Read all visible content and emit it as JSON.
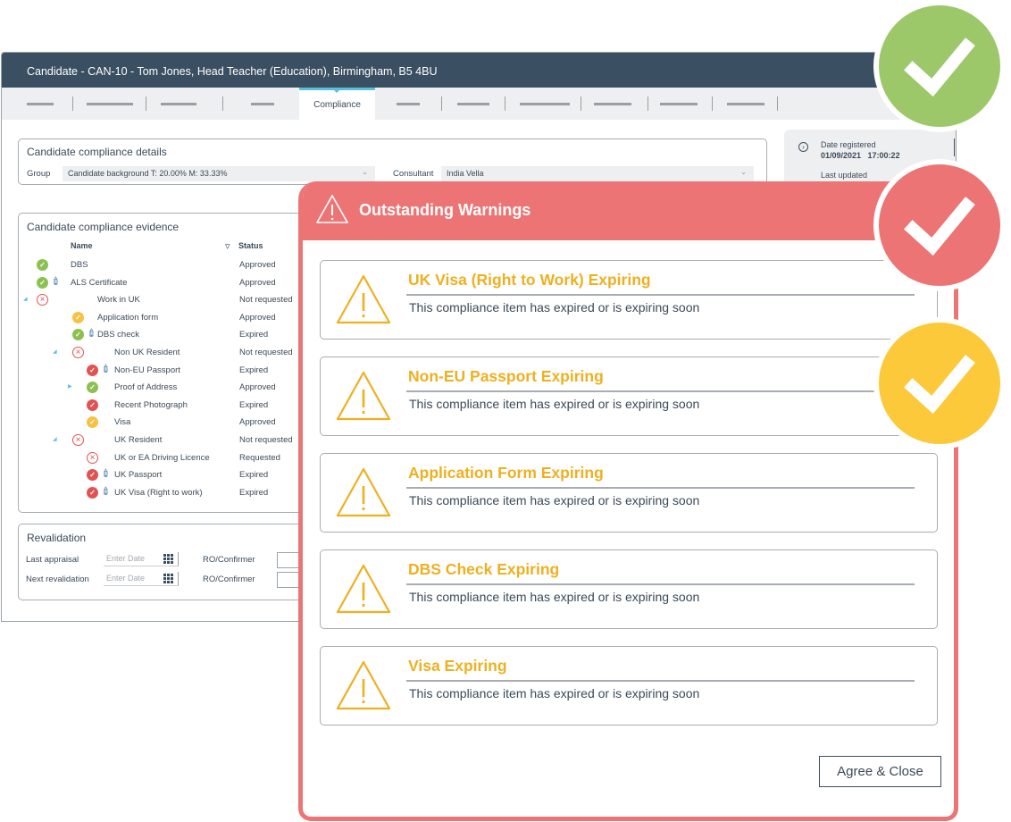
{
  "window": {
    "title": "Candidate - CAN-10 - Tom Jones, Head Teacher (Education), Birmingham, B5 4BU"
  },
  "tabs": {
    "active_label": "Compliance"
  },
  "details": {
    "title": "Candidate compliance details",
    "group_label": "Group",
    "group_value": "Candidate background T: 20.00% M: 33.33%",
    "consultant_label": "Consultant",
    "consultant_value": "India Vella"
  },
  "side": {
    "date_registered_label": "Date registered",
    "date_registered_value": "01/09/2021   17:00:22",
    "last_updated_label": "Last updated"
  },
  "evidence": {
    "title": "Candidate compliance evidence",
    "col_name": "Name",
    "col_status": "Status",
    "rows": [
      {
        "name": "DBS",
        "status": "Approved",
        "icon": "green",
        "attachment": false,
        "indent": 0,
        "expander": ""
      },
      {
        "name": "ALS Certificate",
        "status": "Approved",
        "icon": "green",
        "attachment": true,
        "indent": 0,
        "expander": ""
      },
      {
        "name": "Work in UK",
        "status": "Not requested",
        "icon": "x",
        "attachment": false,
        "indent": 0,
        "expander": "expanded"
      },
      {
        "name": "Application form",
        "status": "Approved",
        "icon": "yellow",
        "attachment": false,
        "indent": 1,
        "expander": ""
      },
      {
        "name": "DBS check",
        "status": "Expired",
        "icon": "green",
        "attachment": true,
        "indent": 1,
        "expander": ""
      },
      {
        "name": "Non UK Resident",
        "status": "Not requested",
        "icon": "x",
        "attachment": false,
        "indent": 1,
        "expander": "expanded"
      },
      {
        "name": "Non-EU Passport",
        "status": "Expired",
        "icon": "red",
        "attachment": true,
        "indent": 2,
        "expander": ""
      },
      {
        "name": "Proof of Address",
        "status": "Approved",
        "icon": "green",
        "attachment": false,
        "indent": 2,
        "expander": "collapsed"
      },
      {
        "name": "Recent Photograph",
        "status": "Expired",
        "icon": "red",
        "attachment": false,
        "indent": 2,
        "expander": ""
      },
      {
        "name": "Visa",
        "status": "Approved",
        "icon": "yellow",
        "attachment": false,
        "indent": 2,
        "expander": ""
      },
      {
        "name": "UK Resident",
        "status": "Not requested",
        "icon": "x",
        "attachment": false,
        "indent": 1,
        "expander": "expanded"
      },
      {
        "name": "UK or EA Driving Licence",
        "status": "Requested",
        "icon": "x",
        "attachment": false,
        "indent": 2,
        "expander": ""
      },
      {
        "name": "UK Passport",
        "status": "Expired",
        "icon": "red",
        "attachment": true,
        "indent": 2,
        "expander": ""
      },
      {
        "name": "UK Visa (Right to work)",
        "status": "Expired",
        "icon": "red",
        "attachment": true,
        "indent": 2,
        "expander": ""
      }
    ]
  },
  "revalidation": {
    "title": "Revalidation",
    "last_appraisal_label": "Last appraisal",
    "next_revalidation_label": "Next revalidation",
    "date_placeholder": "Enter Date",
    "ro_label": "RO/Confirmer"
  },
  "modal": {
    "title": "Outstanding Warnings",
    "warnings": [
      {
        "title": "UK Visa (Right to Work) Expiring",
        "description": "This compliance item has expired or is expiring soon"
      },
      {
        "title": "Non-EU Passport Expiring",
        "description": "This compliance item has expired or is expiring soon"
      },
      {
        "title": "Application Form Expiring",
        "description": "This compliance item has expired or is expiring soon"
      },
      {
        "title": "DBS Check Expiring",
        "description": "This compliance item has expired or is expiring soon"
      },
      {
        "title": "Visa Expiring",
        "description": "This compliance item has expired or is expiring soon"
      }
    ],
    "agree_label": "Agree & Close"
  },
  "colors": {
    "header": "#3a4f61",
    "modal_accent": "#ed7475",
    "warning_title": "#eeb020",
    "badge_green": "#9cc86a",
    "badge_red": "#ed7475",
    "badge_yellow": "#fbc93a"
  }
}
